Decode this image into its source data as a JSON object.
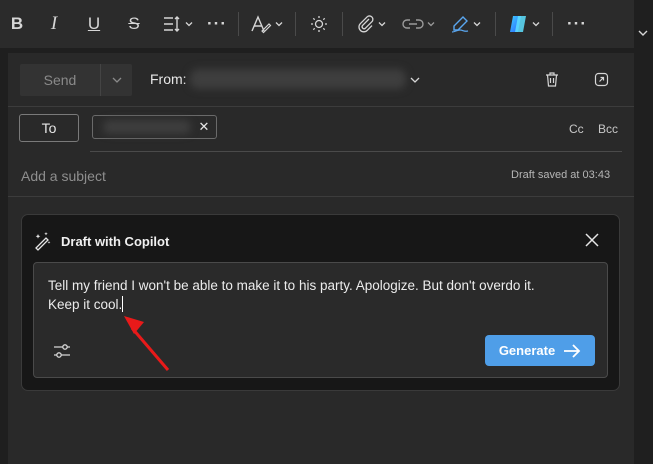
{
  "toolbar": {
    "buttons": [
      {
        "name": "bold-button",
        "glyph": "B"
      },
      {
        "name": "italic-button",
        "glyph": "I"
      },
      {
        "name": "underline-button",
        "glyph": "U"
      },
      {
        "name": "strikethrough-button",
        "glyph": "S"
      }
    ],
    "more_label": "···"
  },
  "compose": {
    "send_label": "Send",
    "from_label": "From:",
    "to_label": "To",
    "cc_label": "Cc",
    "bcc_label": "Bcc",
    "subject_placeholder": "Add a subject",
    "draft_status": "Draft saved at 03:43"
  },
  "copilot": {
    "title": "Draft with Copilot",
    "prompt_line1": "Tell my friend I won't be able to make it to his party. Apologize. But don't overdo it.",
    "prompt_line2": "Keep it cool.",
    "generate_label": "Generate",
    "accent_color": "#4f9ee8"
  }
}
